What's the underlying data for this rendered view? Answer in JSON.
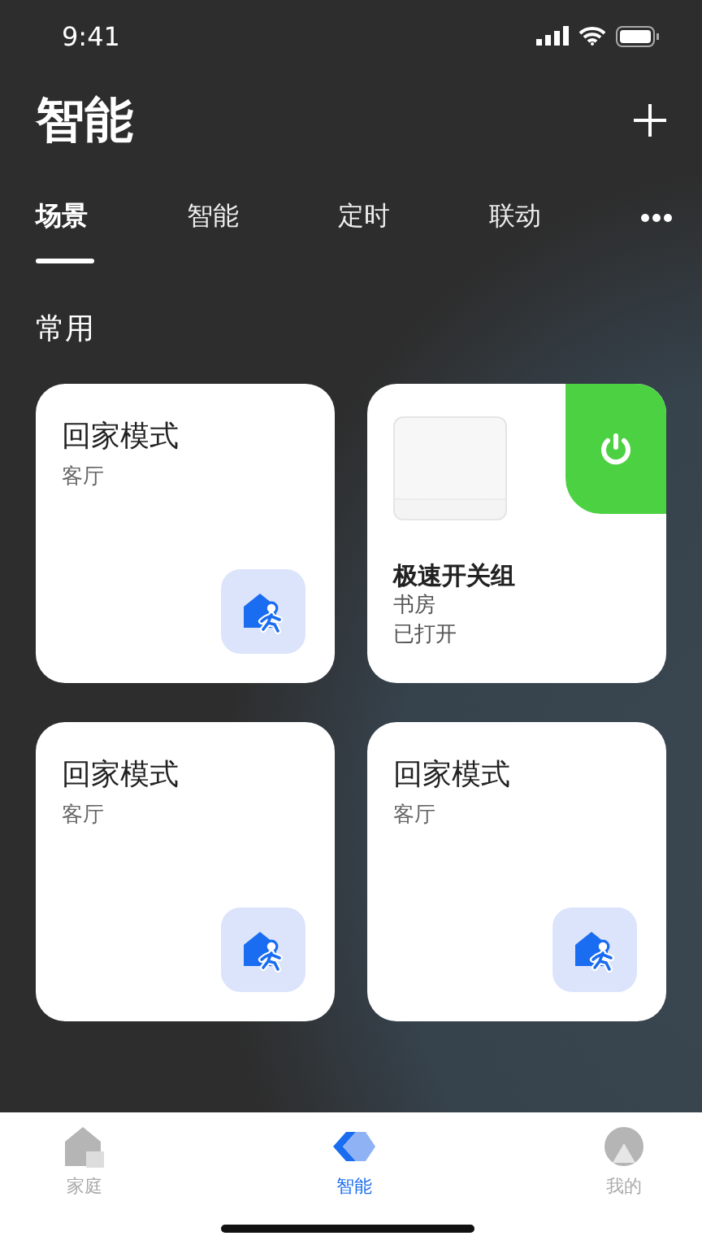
{
  "status_bar": {
    "time": "9:41"
  },
  "header": {
    "title": "智能"
  },
  "tabs": [
    {
      "label": "场景",
      "selected": true
    },
    {
      "label": "智能",
      "selected": false
    },
    {
      "label": "定时",
      "selected": false
    },
    {
      "label": "联动",
      "selected": false
    }
  ],
  "section": {
    "title": "常用"
  },
  "cards": [
    {
      "kind": "scene",
      "name": "回家模式",
      "room": "客厅"
    },
    {
      "kind": "device",
      "name": "极速开关组",
      "room": "书房",
      "status": "已打开",
      "on": true
    },
    {
      "kind": "scene",
      "name": "回家模式",
      "room": "客厅"
    },
    {
      "kind": "scene",
      "name": "回家模式",
      "room": "客厅"
    }
  ],
  "bottom_nav": [
    {
      "label": "家庭",
      "selected": false,
      "kind": "home"
    },
    {
      "label": "智能",
      "selected": true,
      "kind": "smart"
    },
    {
      "label": "我的",
      "selected": false,
      "kind": "profile"
    }
  ]
}
